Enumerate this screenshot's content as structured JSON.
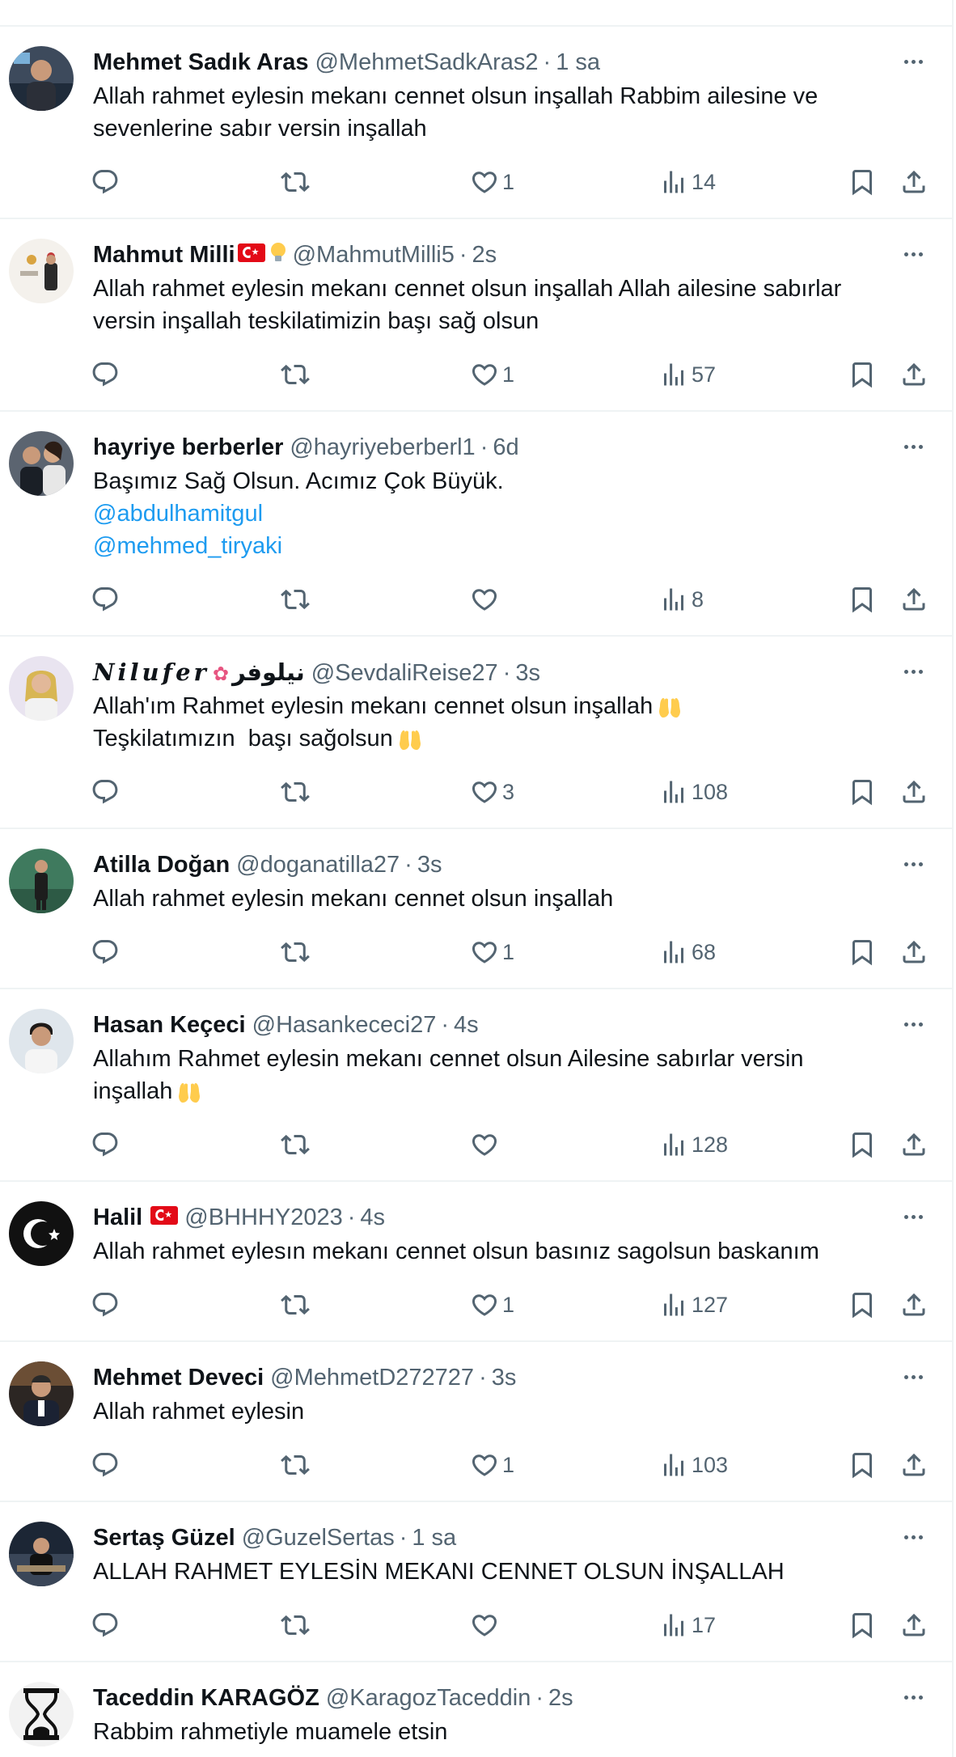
{
  "colors": {
    "text_primary": "#0f1419",
    "text_secondary": "#536471",
    "link": "#1d9bf0",
    "divider": "#eff3f4"
  },
  "tweets": [
    {
      "name": "Mehmet Sadık Aras",
      "handle": "@MehmetSadkAras2",
      "time": "1 sa",
      "lines": [
        "Allah rahmet eylesin mekanı cennet olsun inşallah Rabbim ailesine ve",
        "sevenlerine sabır versin inşallah"
      ],
      "likes": "1",
      "views": "14"
    },
    {
      "name": "Mahmut Milli",
      "handle": "@MahmutMilli5",
      "time": "2s",
      "lines": [
        "Allah rahmet eylesin mekanı cennet olsun inşallah Allah ailesine sabırlar",
        "versin inşallah teskilatimizin başı sağ olsun"
      ],
      "likes": "1",
      "views": "57"
    },
    {
      "name": "hayriye berberler",
      "handle": "@hayriyeberberl1",
      "time": "6d",
      "lines": [
        "Başımız Sağ Olsun. Acımız Çok Büyük."
      ],
      "mentions": [
        "@abdulhamitgul",
        "@mehmed_tiryaki"
      ],
      "likes": "",
      "views": "8"
    },
    {
      "name": "𝑵𝒊𝒍𝒖𝒇𝒆𝒓",
      "name_suffix": "نيلوفر",
      "handle": "@SevdaliReise27",
      "time": "3s",
      "lines": [
        "Allah'ım Rahmet eylesin mekanı cennet olsun inşallah",
        "Teşkilatımızın  başı sağolsun"
      ],
      "likes": "3",
      "views": "108"
    },
    {
      "name": "Atilla Doğan",
      "handle": "@doganatilla27",
      "time": "3s",
      "lines": [
        "Allah rahmet eylesin mekanı cennet olsun inşallah"
      ],
      "likes": "1",
      "views": "68"
    },
    {
      "name": "Hasan Keçeci",
      "handle": "@Hasankececi27",
      "time": "4s",
      "lines": [
        "Allahım Rahmet eylesin mekanı cennet olsun Ailesine sabırlar versin",
        "inşallah"
      ],
      "likes": "",
      "views": "128"
    },
    {
      "name": "Halil",
      "handle": "@BHHHY2023",
      "time": "4s",
      "lines": [
        "Allah rahmet eylesın mekanı cennet olsun basınız sagolsun baskanım"
      ],
      "likes": "1",
      "views": "127"
    },
    {
      "name": "Mehmet Deveci",
      "handle": "@MehmetD272727",
      "time": "3s",
      "lines": [
        "Allah rahmet eylesin"
      ],
      "likes": "1",
      "views": "103"
    },
    {
      "name": "Sertaş Güzel",
      "handle": "@GuzelSertas",
      "time": "1 sa",
      "lines": [
        "ALLAH RAHMET EYLESİN MEKANI CENNET OLSUN İNŞALLAH"
      ],
      "likes": "",
      "views": "17"
    },
    {
      "name": "Taceddin KARAGÖZ",
      "handle": "@KaragozTaceddin",
      "time": "2s",
      "lines": [
        "Rabbim rahmetiyle muamele etsin"
      ],
      "likes": "",
      "views": ""
    }
  ],
  "separator": "·",
  "icons": {
    "reply": "reply-icon",
    "retweet": "retweet-icon",
    "like": "heart-icon",
    "views": "views-icon",
    "bookmark": "bookmark-icon",
    "share": "share-icon",
    "more": "more-icon",
    "hands": "raised-hands-emoji",
    "flag": "turkey-flag-emoji",
    "bulb": "light-bulb-emoji",
    "lotus": "lotus-emoji"
  }
}
